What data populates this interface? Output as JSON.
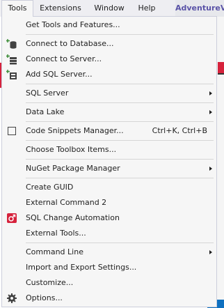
{
  "menubar": {
    "tools": "Tools",
    "extensions": "Extensions",
    "window": "Window",
    "help": "Help",
    "project": "AdventureV"
  },
  "menu": {
    "items": [
      {
        "label": "Get Tools and Features...",
        "icon": null
      },
      {
        "label": "Connect to Database...",
        "icon": "connect-database-icon"
      },
      {
        "label": "Connect to Server...",
        "icon": "connect-server-icon"
      },
      {
        "label": "Add SQL Server...",
        "icon": "add-sql-server-icon"
      },
      {
        "label": "SQL Server",
        "submenu": true
      },
      {
        "label": "Data Lake",
        "submenu": true
      },
      {
        "label": "Code Snippets Manager...",
        "shortcut": "Ctrl+K, Ctrl+B",
        "icon": "code-snippets-icon"
      },
      {
        "label": "Choose Toolbox Items..."
      },
      {
        "label": "NuGet Package Manager",
        "submenu": true
      },
      {
        "label": "Create GUID"
      },
      {
        "label": "External Command 2"
      },
      {
        "label": "SQL Change Automation",
        "icon": "sql-change-automation-icon"
      },
      {
        "label": "External Tools..."
      },
      {
        "label": "Command Line",
        "submenu": true
      },
      {
        "label": "Import and Export Settings..."
      },
      {
        "label": "Customize..."
      },
      {
        "label": "Options...",
        "icon": "gear-icon"
      }
    ]
  },
  "colors": {
    "menu_bg": "#f6f6f6",
    "menubar_bg": "#eeeef2",
    "separator": "#d6d6d6",
    "accent_red": "#d6223c",
    "project_text": "#5a53a7"
  }
}
